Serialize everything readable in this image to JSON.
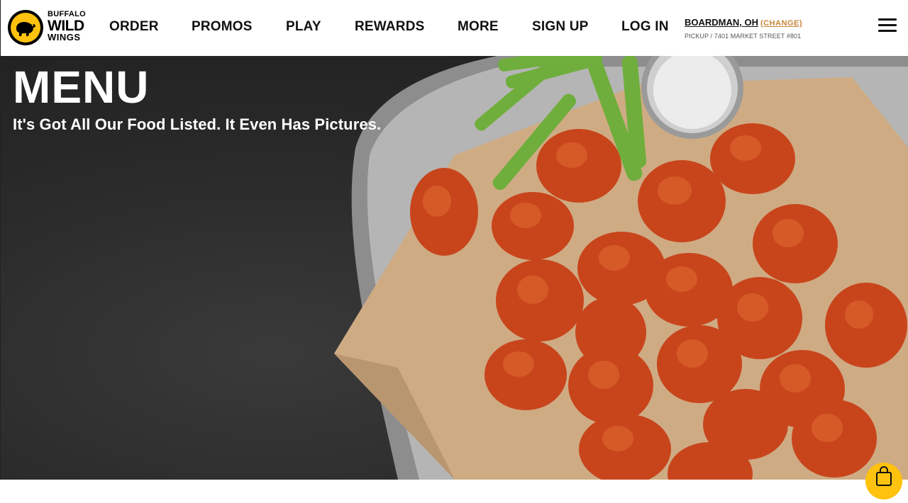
{
  "brand": {
    "logo_line1": "BUFFALO",
    "logo_line2": "WILD",
    "logo_line3": "WINGS",
    "accent_color": "#ffc20e"
  },
  "nav": {
    "items": [
      {
        "label": "ORDER"
      },
      {
        "label": "PROMOS"
      },
      {
        "label": "PLAY"
      },
      {
        "label": "REWARDS"
      },
      {
        "label": "MORE"
      },
      {
        "label": "SIGN UP"
      },
      {
        "label": "LOG IN"
      }
    ]
  },
  "location": {
    "city": "BOARDMAN, OH",
    "change_label": "(CHANGE)",
    "details": "PICKUP / 7401 MARKET STREET #801",
    "change_color": "#c8863a"
  },
  "menu_icon": "hamburger-icon",
  "hero": {
    "title": "MENU",
    "subtitle": "It's Got All Our Food Listed. It Even Has Pictures."
  },
  "cart_icon": "shopping-bag-icon"
}
